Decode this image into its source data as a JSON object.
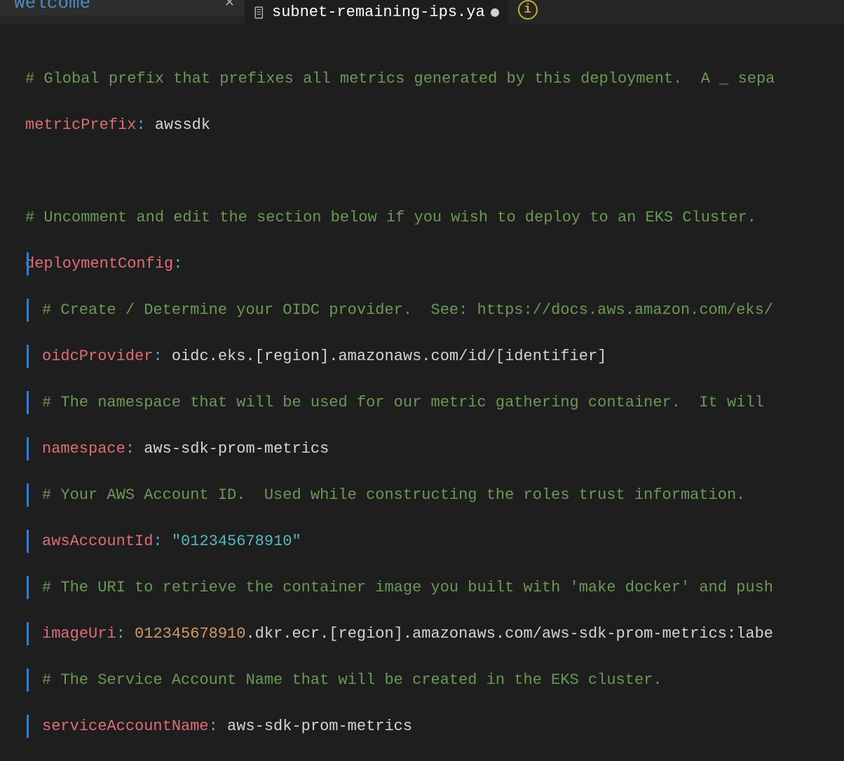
{
  "tabs": {
    "welcome": {
      "label": "Welcome"
    },
    "file": {
      "label": "subnet-remaining-ips.ya"
    }
  },
  "code": {
    "l1_comment": "# Global prefix that prefixes all metrics generated by this deployment.  A _ sepa",
    "l2_key": "metricPrefix",
    "l2_val": "awssdk",
    "l4_comment": "# Uncomment and edit the section below if you wish to deploy to an EKS Cluster.",
    "l5_key": "deploymentConfig",
    "l6_comment": "# Create / Determine your OIDC provider.  See: https://docs.aws.amazon.com/eks/",
    "l7_key": "oidcProvider",
    "l7_val": "oidc.eks.[region].amazonaws.com/id/[identifier]",
    "l8_comment": "# The namespace that will be used for our metric gathering container.  It will ",
    "l9_key": "namespace",
    "l9_val": "aws-sdk-prom-metrics",
    "l10_comment": "# Your AWS Account ID.  Used while constructing the roles trust information.",
    "l11_key": "awsAccountId",
    "l11_val": "\"012345678910\"",
    "l12_comment": "# The URI to retrieve the container image you built with 'make docker' and push",
    "l13_key": "imageUri",
    "l13_num": "012345678910",
    "l13_rest": ".dkr.ecr.[region].amazonaws.com/aws-sdk-prom-metrics:labe",
    "l14_comment": "# The Service Account Name that will be created in the EKS cluster.",
    "l15_key": "serviceAccountName",
    "l15_val": "aws-sdk-prom-metrics"
  }
}
